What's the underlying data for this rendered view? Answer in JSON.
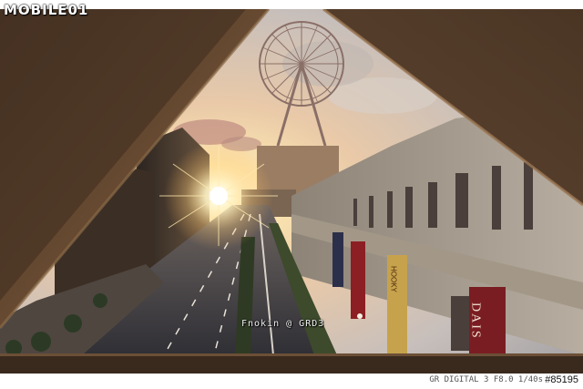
{
  "logo": {
    "text": "MOBILE01"
  },
  "photo": {
    "description_label": "",
    "watermark": "Fnokin @ GRD3",
    "signs": {
      "left_banner": "HOOKY",
      "right_banner": "DAIS"
    }
  },
  "footer": {
    "camera_info": "GR DIGITAL 3 F8.0 1/40s",
    "post_number": "#85195"
  },
  "colors": {
    "sky_top": "#cfc9c2",
    "sun": "#fff6d8",
    "beam": "#6b4a2f",
    "road": "#3f3f45"
  }
}
